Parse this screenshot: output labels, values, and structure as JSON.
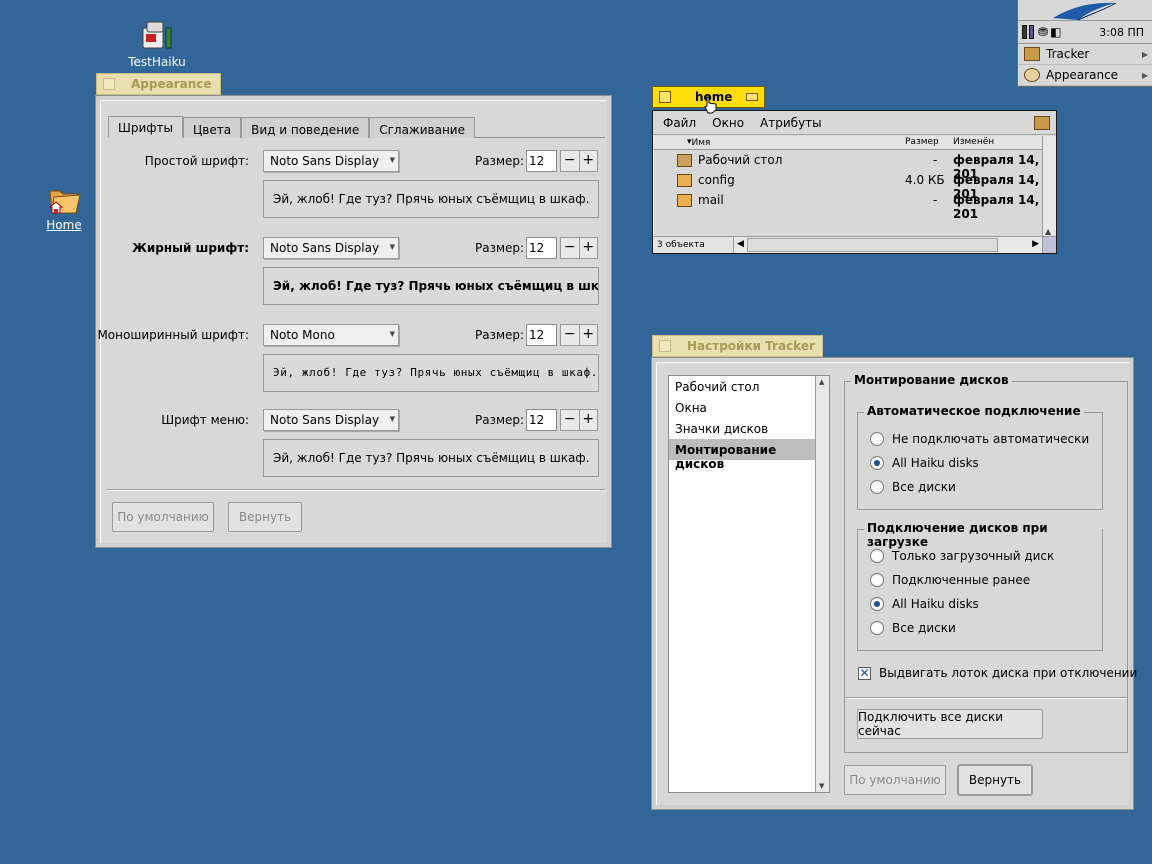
{
  "desktop": {
    "icons": [
      {
        "label": "TestHaiku",
        "icon": "testhaiku-app-icon"
      },
      {
        "label": "Home",
        "icon": "home-folder-icon"
      }
    ]
  },
  "deskbar": {
    "clock": "3:08 ПП",
    "items": [
      {
        "label": "Tracker",
        "icon": "tracker-icon"
      },
      {
        "label": "Appearance",
        "icon": "appearance-icon"
      }
    ]
  },
  "appearance": {
    "title": "Appearance",
    "tabs": [
      "Шрифты",
      "Цвета",
      "Вид и поведение",
      "Сглаживание"
    ],
    "size_label": "Размер:",
    "rows": [
      {
        "label": "Простой шрифт:",
        "font": "Noto Sans Display",
        "size": "12",
        "preview": "Эй, жлоб! Где туз? Прячь юных съёмщиц в шкаф."
      },
      {
        "label": "Жирный шрифт:",
        "font": "Noto Sans Display",
        "size": "12",
        "preview": "Эй, жлоб! Где туз? Прячь юных съёмщиц в шкаф."
      },
      {
        "label": "Моноширинный шрифт:",
        "font": "Noto Mono",
        "size": "12",
        "preview": "Эй, жлоб! Где туз? Прячь юных съёмщиц в шкаф."
      },
      {
        "label": "Шрифт меню:",
        "font": "Noto Sans Display",
        "size": "12",
        "preview": "Эй, жлоб! Где туз? Прячь юных съёмщиц в шкаф."
      }
    ],
    "buttons": {
      "defaults": "По умолчанию",
      "revert": "Вернуть"
    }
  },
  "home": {
    "title": "home",
    "menu": [
      "Файл",
      "Окно",
      "Атрибуты"
    ],
    "columns": {
      "name": "Имя",
      "size": "Размер",
      "modified": "Изменён"
    },
    "files": [
      {
        "name": "Рабочий стол",
        "size": "-",
        "modified": "февраля 14, 201"
      },
      {
        "name": "config",
        "size": "4.0 КБ",
        "modified": "февраля 14, 201"
      },
      {
        "name": "mail",
        "size": "-",
        "modified": "февраля 14, 201"
      }
    ],
    "status": "3 объекта"
  },
  "tracker_prefs": {
    "title": "Настройки Tracker",
    "categories": [
      "Рабочий стол",
      "Окна",
      "Значки дисков",
      "Монтирование дисков"
    ],
    "section_title": "Монтирование дисков",
    "auto_group": {
      "title": "Автоматическое подключение",
      "options": [
        "Не подключать автоматически",
        "All Haiku disks",
        "Все диски"
      ],
      "selected": 1
    },
    "boot_group": {
      "title": "Подключение дисков при загрузке",
      "options": [
        "Только загрузочный диск",
        "Подключенные ранее",
        "All Haiku disks",
        "Все диски"
      ],
      "selected": 2
    },
    "eject_label": "Выдвигать лоток диска при отключении",
    "eject_checked": true,
    "mount_all_button": "Подключить все диски сейчас",
    "buttons": {
      "defaults": "По умолчанию",
      "revert": "Вернуть"
    }
  }
}
